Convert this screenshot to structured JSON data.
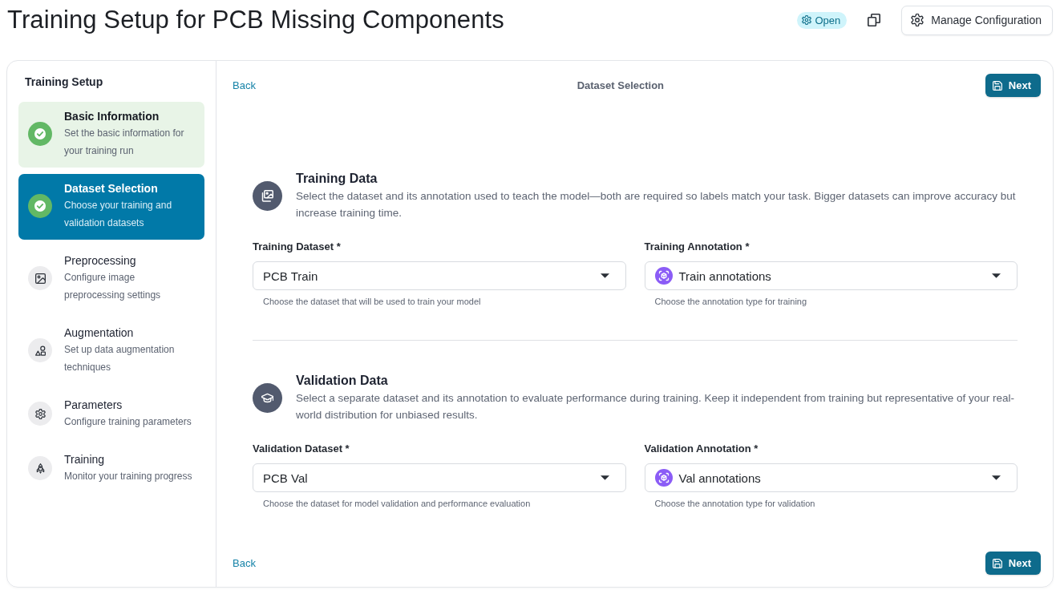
{
  "header": {
    "title": "Training Setup for PCB Missing Components",
    "status_badge": {
      "label": "Open"
    },
    "manage_button": {
      "label": "Manage Configuration"
    }
  },
  "sidebar": {
    "title": "Training Setup",
    "steps": [
      {
        "title": "Basic Information",
        "description": "Set the basic information for your training run",
        "completed": true,
        "selected": false
      },
      {
        "title": "Dataset Selection",
        "description": "Choose your training and validation datasets",
        "completed": true,
        "selected": true
      },
      {
        "title": "Preprocessing",
        "description": "Configure image preprocessing settings",
        "completed": false,
        "selected": false
      },
      {
        "title": "Augmentation",
        "description": "Set up data augmentation techniques",
        "completed": false,
        "selected": false
      },
      {
        "title": "Parameters",
        "description": "Configure training parameters",
        "completed": false,
        "selected": false
      },
      {
        "title": "Training",
        "description": "Monitor your training progress",
        "completed": false,
        "selected": false
      }
    ]
  },
  "main": {
    "top_bar": {
      "back_link": "Back",
      "step_title": "Dataset Selection",
      "next_button": "Next"
    },
    "sections": [
      {
        "title": "Training Data",
        "description": "Select the dataset and its annotation used to teach the model—both are required so labels match your task. Bigger datasets can improve accuracy but increase training time.",
        "fields": [
          {
            "kind": "dataset",
            "label": "Training Dataset",
            "required_mark": "*",
            "value": "PCB Train",
            "helper": "Choose the dataset that will be used to train your model"
          },
          {
            "kind": "annotation",
            "label": "Training Annotation",
            "required_mark": "*",
            "value": "Train annotations",
            "helper": "Choose the annotation type for training"
          }
        ]
      },
      {
        "title": "Validation Data",
        "description": "Select a separate dataset and its annotation to evaluate performance during training. Keep it independent from training but representative of your real-world distribution for unbiased results.",
        "fields": [
          {
            "kind": "dataset",
            "label": "Validation Dataset",
            "required_mark": "*",
            "value": "PCB Val",
            "helper": "Choose the dataset for model validation and performance evaluation"
          },
          {
            "kind": "annotation",
            "label": "Validation Annotation",
            "required_mark": "*",
            "value": "Val annotations",
            "helper": "Choose the annotation type for validation"
          }
        ]
      }
    ],
    "bottom_bar": {
      "back_link": "Back",
      "next_button": "Next"
    }
  }
}
